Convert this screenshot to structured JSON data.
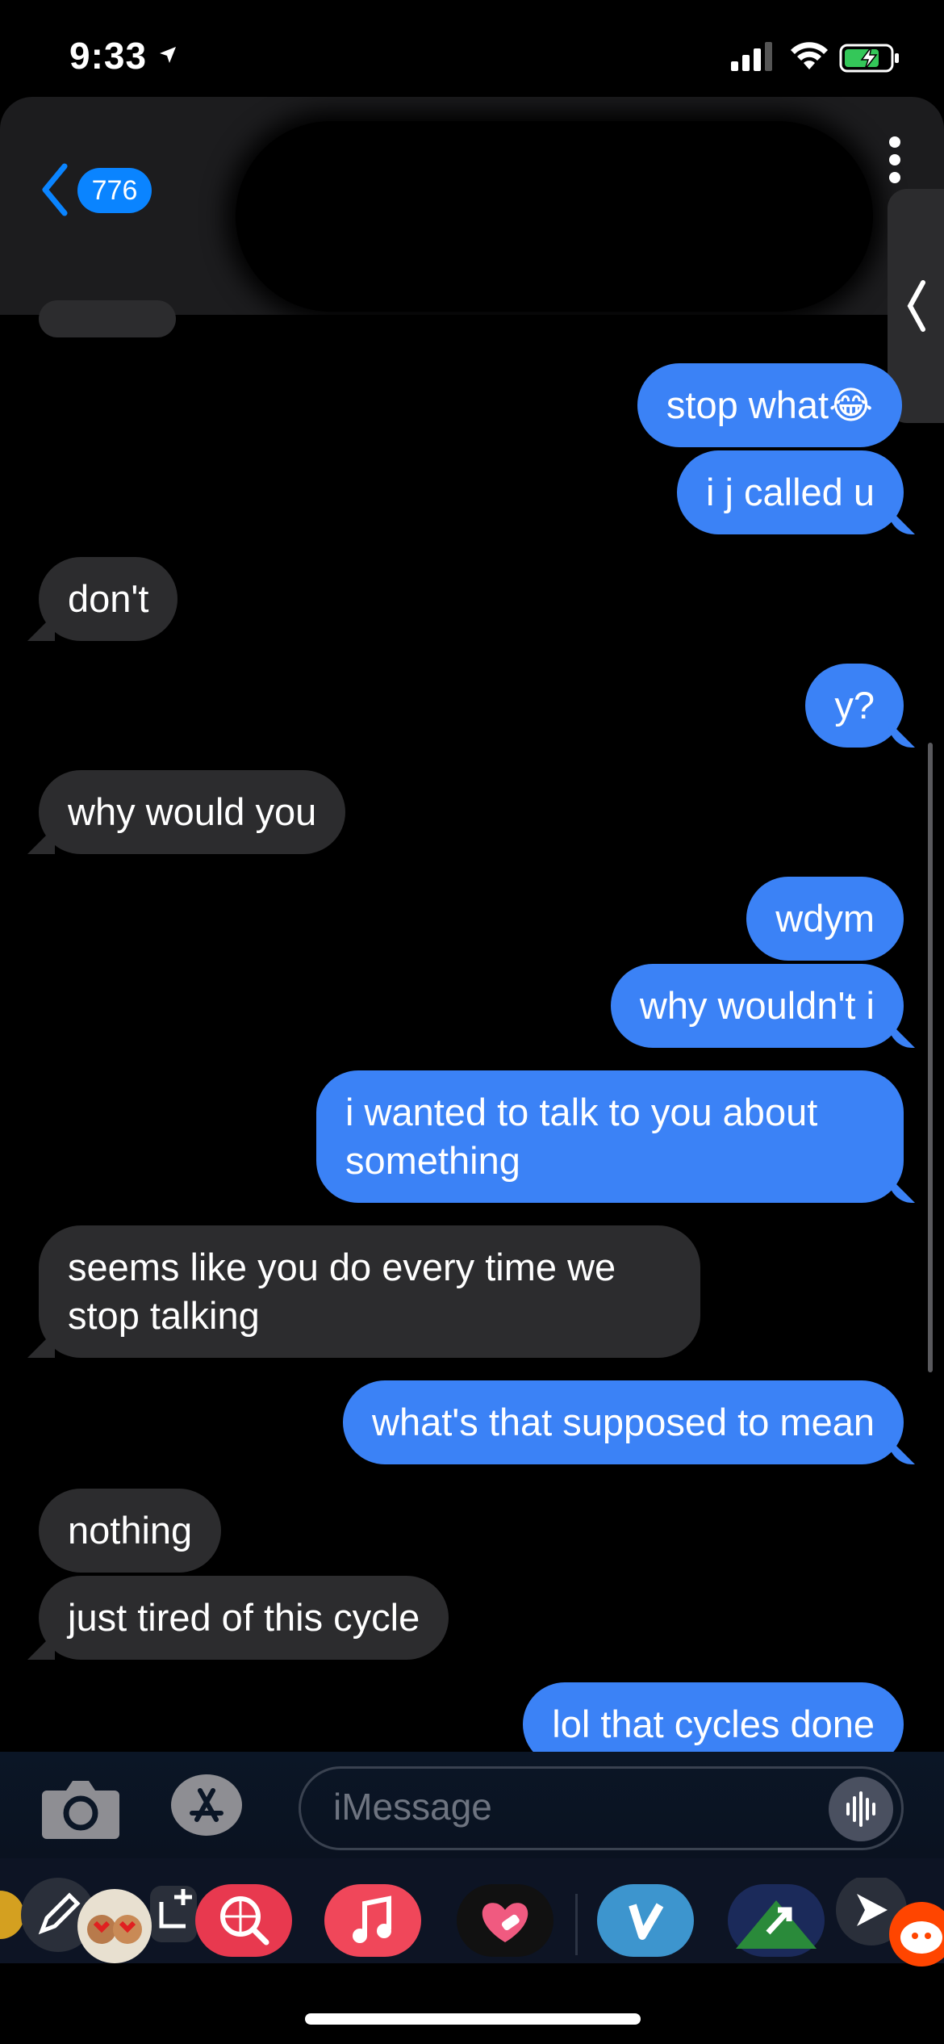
{
  "status_bar": {
    "time": "9:33"
  },
  "header": {
    "back_count": "776"
  },
  "messages": [
    {
      "text": "stop what",
      "emoji": "😂",
      "side": "sent"
    },
    {
      "text": "i j called u",
      "side": "sent"
    },
    {
      "text": "don't",
      "side": "received"
    },
    {
      "text": "y?",
      "side": "sent"
    },
    {
      "text": "why would you",
      "side": "received"
    },
    {
      "text": "wdym",
      "side": "sent"
    },
    {
      "text": "why wouldn't i",
      "side": "sent"
    },
    {
      "text": "i wanted to talk to you about something",
      "side": "sent"
    },
    {
      "text": "seems like you do every time we stop talking",
      "side": "received"
    },
    {
      "text": "what's that supposed to mean",
      "side": "sent"
    },
    {
      "text": "nothing",
      "side": "received"
    },
    {
      "text": "just tired of this cycle",
      "side": "received"
    },
    {
      "text": "lol that cycles done",
      "side": "sent"
    }
  ],
  "composer": {
    "placeholder": "iMessage"
  },
  "app_drawer": [
    {
      "icon": "edit-icon"
    },
    {
      "icon": "memoji-sticker-icon"
    },
    {
      "icon": "image-search-icon"
    },
    {
      "icon": "music-icon"
    },
    {
      "icon": "digital-touch-icon"
    },
    {
      "icon": "venmo-icon"
    },
    {
      "icon": "game-icon"
    },
    {
      "icon": "reddit-icon"
    }
  ],
  "colors": {
    "sent_bubble": "#3b82f6",
    "received_bubble": "#2c2c2e",
    "accent": "#0a84ff",
    "music": "#f0475a",
    "image_search": "#e8394f",
    "venmo": "#3d95ce"
  }
}
